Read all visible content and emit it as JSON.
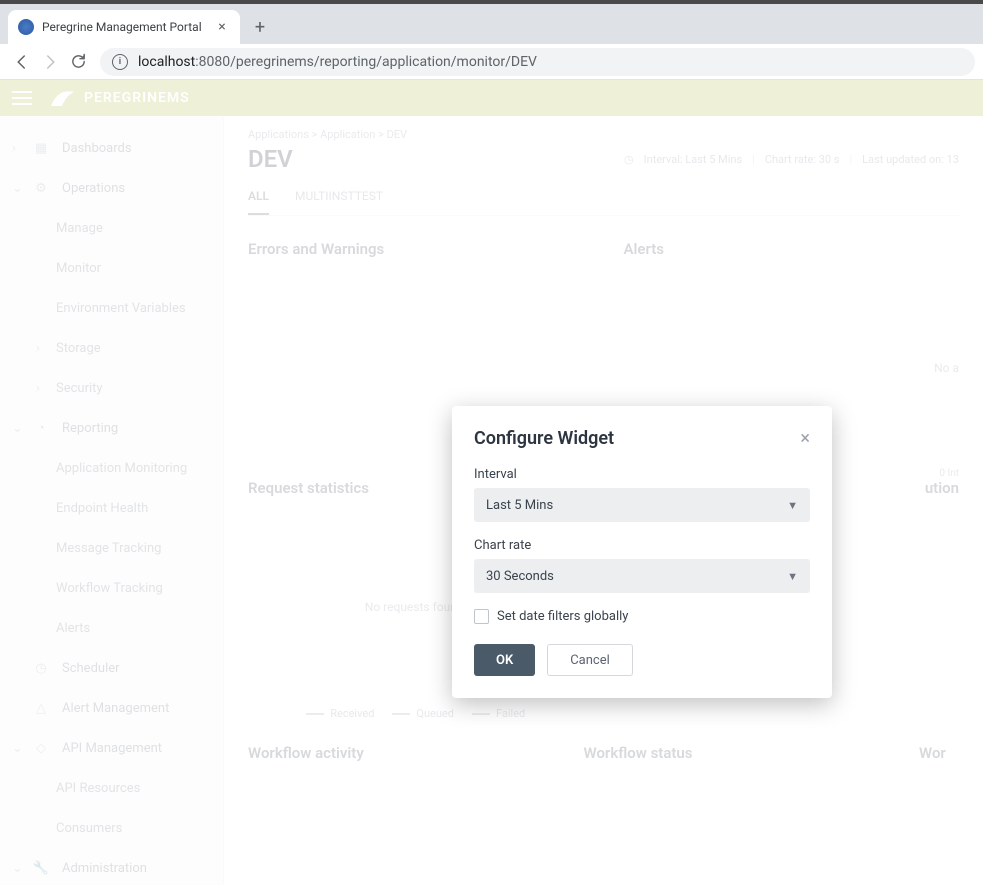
{
  "browser": {
    "tab_title": "Peregrine Management Portal",
    "url_host": "localhost",
    "url_port": ":8080",
    "url_path": "/peregrinems/reporting/application/monitor/DEV"
  },
  "brand": {
    "name": "PEREGRINEMS"
  },
  "sidebar": {
    "items": [
      {
        "label": "Dashboards"
      },
      {
        "label": "Operations"
      },
      {
        "label": "Manage"
      },
      {
        "label": "Monitor"
      },
      {
        "label": "Environment Variables"
      },
      {
        "label": "Storage"
      },
      {
        "label": "Security"
      },
      {
        "label": "Reporting"
      },
      {
        "label": "Application Monitoring"
      },
      {
        "label": "Endpoint Health"
      },
      {
        "label": "Message Tracking"
      },
      {
        "label": "Workflow Tracking"
      },
      {
        "label": "Alerts"
      },
      {
        "label": "Scheduler"
      },
      {
        "label": "Alert Management"
      },
      {
        "label": "API Management"
      },
      {
        "label": "API Resources"
      },
      {
        "label": "Consumers"
      },
      {
        "label": "Administration"
      }
    ]
  },
  "page": {
    "breadcrumb": "Applications > Application > DEV",
    "title": "DEV",
    "meta_interval_label": "Interval:",
    "meta_interval_value": "Last 5 Mins",
    "meta_rate_label": "Chart rate:",
    "meta_rate_value": "30 s",
    "meta_updated_label": "Last updated on:",
    "meta_updated_value": "13",
    "tabs": [
      {
        "label": "ALL"
      },
      {
        "label": "MULTIINSTTEST"
      }
    ],
    "widgets": {
      "errors": "Errors and Warnings",
      "alerts": "Alerts",
      "alerts_empty": "No a",
      "dist_badge": "0 Int",
      "requests": "Request statistics",
      "requests_empty": "No requests found!",
      "distribution": "ution",
      "legend": [
        "Received",
        "Queued",
        "Failed"
      ],
      "wf_activity": "Workflow activity",
      "wf_status": "Workflow status",
      "wf_third": "Wor"
    }
  },
  "modal": {
    "title": "Configure Widget",
    "interval_label": "Interval",
    "interval_value": "Last 5 Mins",
    "rate_label": "Chart rate",
    "rate_value": "30 Seconds",
    "global_label": "Set date filters globally",
    "ok": "OK",
    "cancel": "Cancel"
  }
}
